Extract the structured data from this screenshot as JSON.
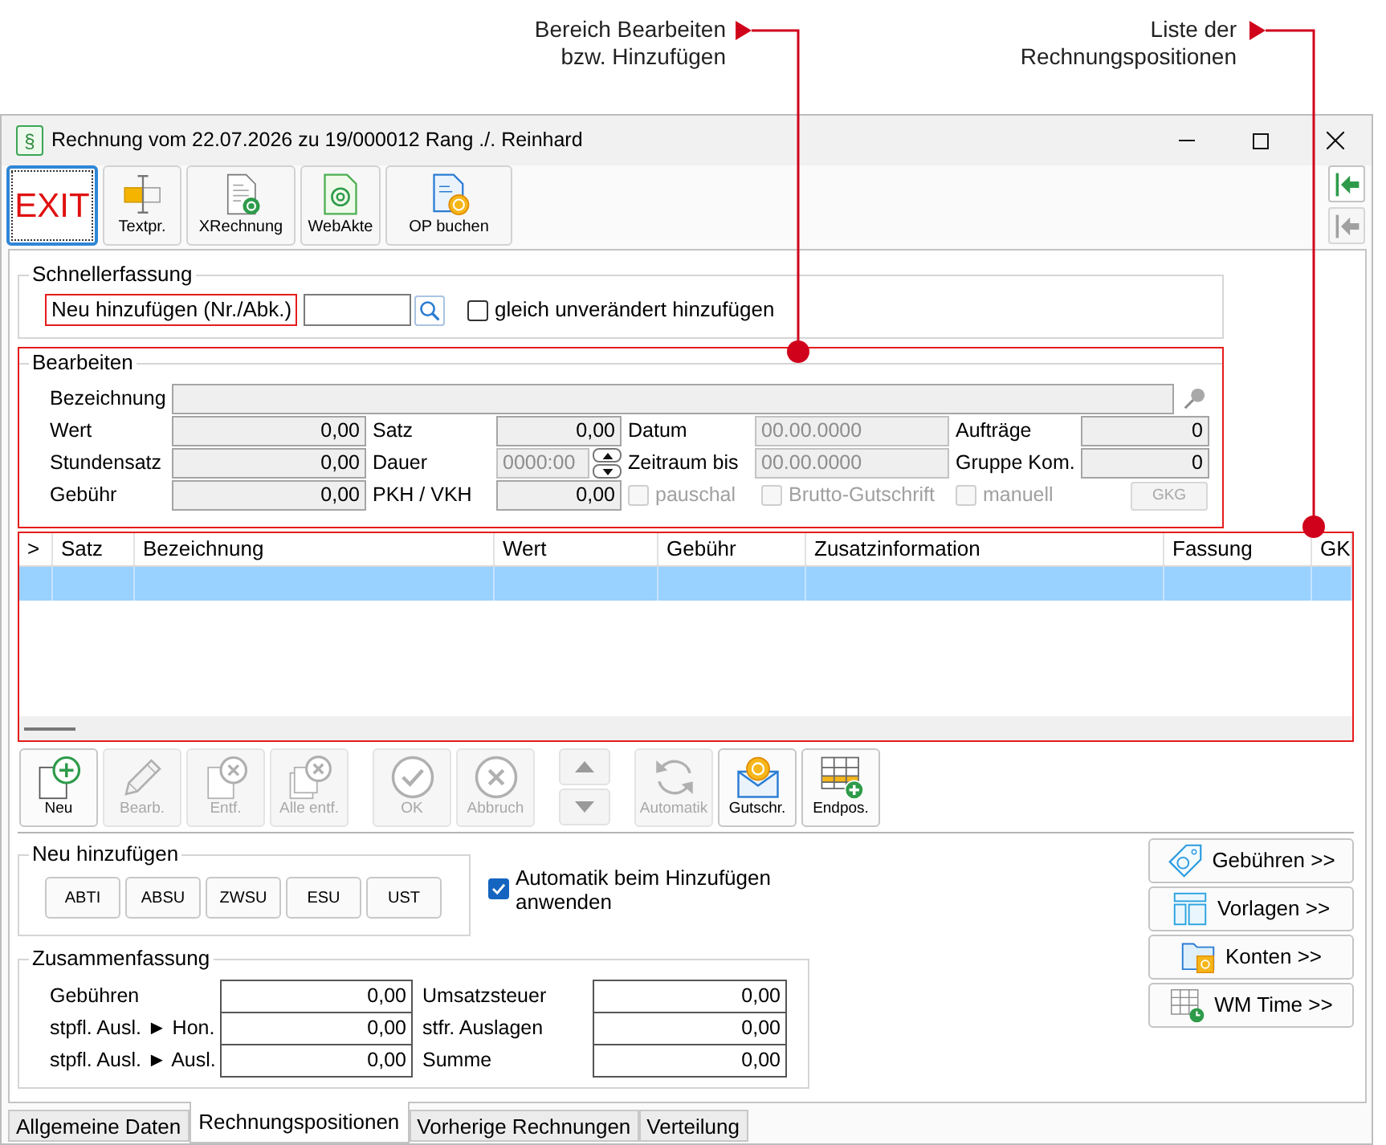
{
  "callouts": [
    {
      "lines": [
        "Bereich Bearbeiten",
        "bzw. Hinzufügen"
      ]
    },
    {
      "lines": [
        "Liste der",
        "Rechnungspositionen"
      ]
    }
  ],
  "window": {
    "icon": "§",
    "title": "Rechnung vom 22.07.2026 zu 19/000012 Rang ./. Reinhard"
  },
  "toolbar": [
    {
      "kind": "exit",
      "label": "EXIT",
      "focused": true
    },
    {
      "kind": "text",
      "label": "Textpr.",
      "focused": false
    },
    {
      "kind": "xrechnung",
      "label": "XRechnung",
      "focused": false
    },
    {
      "kind": "webakte",
      "label": "WebAkte",
      "focused": false
    },
    {
      "kind": "op",
      "label": "OP buchen",
      "focused": false
    }
  ],
  "side_buttons": [
    {
      "disabled": false
    },
    {
      "disabled": true
    }
  ],
  "quick_entry": {
    "title": "Schnellerfassung",
    "label": "Neu hinzufügen (Nr./Abk.)",
    "checkbox": {
      "label": "gleich unverändert hinzufügen",
      "checked": false
    }
  },
  "edit": {
    "title": "Bearbeiten",
    "rows": [
      [
        {
          "kind": "wide_field",
          "label": "Bezeichnung"
        }
      ],
      [
        {
          "kind": "number_field",
          "label": "Wert",
          "value": "0,00",
          "disabled": false
        },
        {
          "kind": "number_field",
          "label": "Satz",
          "value": "0,00",
          "disabled": false
        },
        {
          "kind": "date_field",
          "label": "Datum",
          "value": "00.00.0000",
          "disabled": true
        },
        {
          "kind": "number_field",
          "label": "Aufträge",
          "value": "0",
          "disabled": false
        }
      ],
      [
        {
          "kind": "number_field",
          "label": "Stundensatz",
          "value": "0,00",
          "disabled": false
        },
        {
          "kind": "spin_field",
          "label": "Dauer",
          "value": "0000:00",
          "disabled": true
        },
        {
          "kind": "date_field",
          "label": "Zeitraum bis",
          "value": "00.00.0000",
          "disabled": true
        },
        {
          "kind": "number_field",
          "label": "Gruppe Kom.",
          "value": "0",
          "disabled": false
        }
      ],
      [
        {
          "kind": "number_field",
          "label": "Gebühr",
          "value": "0,00",
          "disabled": false
        },
        {
          "kind": "number_field",
          "label": "PKH / VKH",
          "value": "0,00",
          "disabled": false
        },
        {
          "kind": "checkbox",
          "label": "pauschal",
          "checked": false,
          "disabled": true
        },
        {
          "kind": "checkbox",
          "label": "Brutto-Gutschrift",
          "checked": false,
          "disabled": true
        },
        {
          "kind": "checkbox",
          "label": "manuell",
          "checked": false,
          "disabled": true
        },
        {
          "kind": "button",
          "label": "GKG",
          "disabled": true
        }
      ]
    ]
  },
  "table": {
    "columns": [
      ">",
      "Satz",
      "Bezeichnung",
      "Wert",
      "Gebühr",
      "Zusatzinformation",
      "Fassung",
      "GK"
    ],
    "rows": [
      {
        "selected": true
      }
    ]
  },
  "table_toolbar": {
    "groups": [
      {
        "kind": "buttons",
        "items": [
          {
            "kind": "new",
            "label": "Neu",
            "disabled": false
          },
          {
            "kind": "edit",
            "label": "Bearb.",
            "disabled": true
          },
          {
            "kind": "remove",
            "label": "Entf.",
            "disabled": true
          },
          {
            "kind": "remove_all",
            "label": "Alle entf.",
            "disabled": true
          }
        ]
      },
      {
        "kind": "buttons",
        "items": [
          {
            "kind": "ok",
            "label": "OK",
            "disabled": true
          },
          {
            "kind": "cancel",
            "label": "Abbruch",
            "disabled": true
          }
        ]
      },
      {
        "kind": "arrows",
        "items": [
          {
            "kind": "up"
          },
          {
            "kind": "down"
          }
        ]
      },
      {
        "kind": "buttons",
        "items": [
          {
            "kind": "auto",
            "label": "Automatik",
            "disabled": true
          },
          {
            "kind": "credit",
            "label": "Gutschr.",
            "disabled": false
          },
          {
            "kind": "endpos",
            "label": "Endpos.",
            "disabled": false
          }
        ]
      }
    ]
  },
  "add_new": {
    "title": "Neu hinzufügen",
    "buttons": [
      "ABTI",
      "ABSU",
      "ZWSU",
      "ESU",
      "UST"
    ]
  },
  "auto_apply": {
    "label": "Automatik beim Hinzufügen anwenden",
    "checked": true
  },
  "side_panel_buttons": [
    {
      "kind": "fees",
      "label": "Gebühren >>"
    },
    {
      "kind": "templates",
      "label": "Vorlagen >>"
    },
    {
      "kind": "accounts",
      "label": "Konten >>"
    },
    {
      "kind": "time",
      "label": "WM Time >>"
    }
  ],
  "summary": {
    "title": "Zusammenfassung",
    "rows": [
      [
        {
          "label": "Gebühren",
          "value": "0,00"
        },
        {
          "label": "Umsatzsteuer",
          "value": "0,00"
        }
      ],
      [
        {
          "label": "stpfl. Ausl. ► Hon.",
          "value": "0,00"
        },
        {
          "label": "stfr. Auslagen",
          "value": "0,00"
        }
      ],
      [
        {
          "label": "stpfl. Ausl. ► Ausl.",
          "value": "0,00"
        },
        {
          "label": "Summe",
          "value": "0,00"
        }
      ]
    ]
  },
  "tabs": [
    {
      "label": "Allgemeine Daten",
      "selected": false
    },
    {
      "label": "Rechnungspositionen",
      "selected": true
    },
    {
      "label": "Vorherige Rechnungen",
      "selected": false
    },
    {
      "label": "Verteilung",
      "selected": false
    }
  ]
}
